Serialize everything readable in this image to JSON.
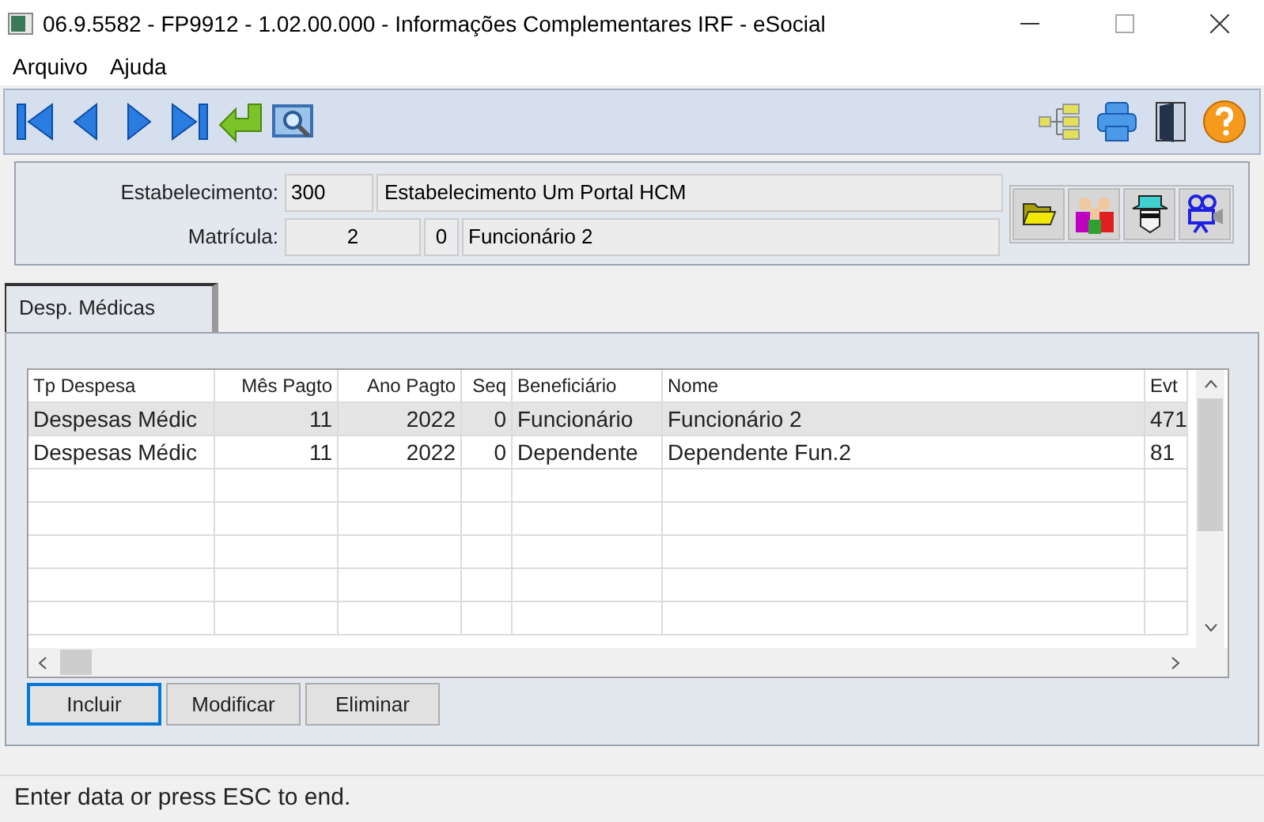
{
  "window": {
    "title": "06.9.5582 - FP9912 - 1.02.00.000 - Informações Complementares IRF - eSocial"
  },
  "menu": [
    "Arquivo",
    "Ajuda"
  ],
  "header": {
    "estabelecimento_label": "Estabelecimento:",
    "estabelecimento_code": "300",
    "estabelecimento_name": "Estabelecimento Um Portal HCM",
    "matricula_label": "Matrícula:",
    "matricula": "2",
    "matricula_digit": "0",
    "matricula_name": "Funcionário 2"
  },
  "tabs": [
    {
      "label": "Desp. Médicas",
      "selected": true
    }
  ],
  "table": {
    "columns": [
      {
        "label": "Tp Despesa"
      },
      {
        "label": "Mês Pagto"
      },
      {
        "label": "Ano Pagto"
      },
      {
        "label": "Seq"
      },
      {
        "label": "Beneficiário"
      },
      {
        "label": "Nome"
      },
      {
        "label": "Evt"
      }
    ],
    "rows": [
      {
        "selected": true,
        "cells": [
          "Despesas Médic",
          "11",
          "2022",
          "0",
          "Funcionário",
          "Funcionário 2",
          "471"
        ]
      },
      {
        "selected": false,
        "cells": [
          "Despesas Médic",
          "11",
          "2022",
          "0",
          "Dependente",
          "Dependente Fun.2",
          "81"
        ]
      }
    ]
  },
  "buttons": [
    {
      "label": "Incluir",
      "focused": true
    },
    {
      "label": "Modificar",
      "focused": false
    },
    {
      "label": "Eliminar",
      "focused": false
    }
  ],
  "status_bar": "Enter data or press ESC to end."
}
